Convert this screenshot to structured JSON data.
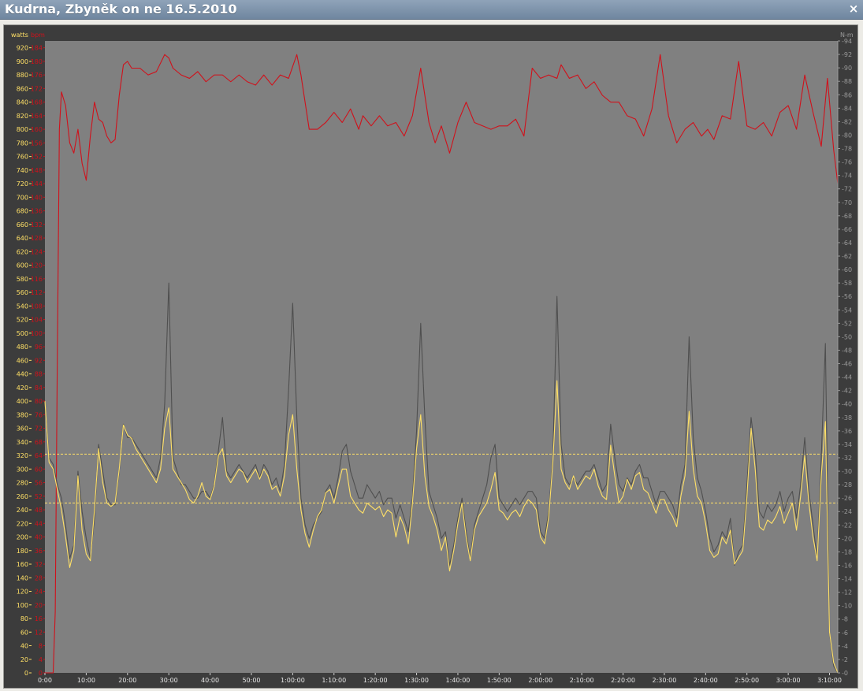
{
  "window": {
    "title": "Kudrna, Zbyněk on ne 16.5.2010",
    "close_glyph": "×"
  },
  "colors": {
    "plot_bg": "#808080",
    "outer_bg": "#3c3c3c",
    "watts": "#ffe066",
    "bpm": "#d0111b",
    "torque": "#4f4f4f",
    "threshold": "#ffe066",
    "right_axis": "#9a9a9a"
  },
  "chart_data": {
    "type": "line",
    "x_unit": "time (h:mm:ss)",
    "xlim": [
      0,
      192
    ],
    "x_ticks": [
      {
        "v": 0,
        "label": "0:00"
      },
      {
        "v": 10,
        "label": "10:00"
      },
      {
        "v": 20,
        "label": "20:00"
      },
      {
        "v": 30,
        "label": "30:00"
      },
      {
        "v": 40,
        "label": "40:00"
      },
      {
        "v": 50,
        "label": "50:00"
      },
      {
        "v": 60,
        "label": "1:00:00"
      },
      {
        "v": 70,
        "label": "1:10:00"
      },
      {
        "v": 80,
        "label": "1:20:00"
      },
      {
        "v": 90,
        "label": "1:30:00"
      },
      {
        "v": 100,
        "label": "1:40:00"
      },
      {
        "v": 110,
        "label": "1:50:00"
      },
      {
        "v": 120,
        "label": "2:00:00"
      },
      {
        "v": 130,
        "label": "2:10:00"
      },
      {
        "v": 140,
        "label": "2:20:00"
      },
      {
        "v": 150,
        "label": "2:30:00"
      },
      {
        "v": 160,
        "label": "2:40:00"
      },
      {
        "v": 170,
        "label": "2:50:00"
      },
      {
        "v": 180,
        "label": "3:00:00"
      },
      {
        "v": 190,
        "label": "3:10:00"
      }
    ],
    "axes": {
      "watts": {
        "label": "watts",
        "min": 0,
        "max": 930,
        "tick_step": 20,
        "tick_max": 920
      },
      "bpm": {
        "label": "bpm",
        "min": 0,
        "max": 186,
        "tick_step": 4,
        "tick_max": 184
      },
      "torque": {
        "label": "N-m",
        "min": 0,
        "max": 94,
        "tick_step": 2,
        "tick_max": 94
      }
    },
    "thresholds_watts": [
      322,
      250
    ],
    "series": [
      {
        "key": "bpm",
        "axis": "bpm",
        "x": [
          0,
          2,
          2.5,
          3,
          3.5,
          4,
          5,
          6,
          7,
          8,
          9,
          10,
          11,
          12,
          13,
          14,
          15,
          16,
          17,
          18,
          19,
          20,
          21,
          23,
          25,
          27,
          29,
          30,
          31,
          33,
          35,
          37,
          39,
          41,
          43,
          45,
          47,
          49,
          51,
          53,
          55,
          57,
          59,
          61,
          62,
          64,
          66,
          68,
          70,
          72,
          74,
          76,
          77,
          79,
          81,
          83,
          85,
          87,
          89,
          91,
          93,
          94.5,
          96,
          98,
          100,
          102,
          104,
          106,
          108,
          110,
          112,
          114,
          116,
          118,
          120,
          122,
          124,
          125,
          127,
          129,
          131,
          133,
          135,
          137,
          139,
          141,
          143,
          145,
          147,
          149,
          151,
          153,
          155,
          157,
          159,
          160.5,
          162,
          164,
          166,
          168,
          170,
          172,
          174,
          176,
          178,
          180,
          182,
          184,
          186,
          188,
          189.5,
          191,
          192
        ],
        "values": [
          0,
          0,
          18,
          92,
          160,
          171,
          167,
          156,
          153,
          160,
          150,
          145,
          158,
          168,
          163,
          162,
          158,
          156,
          157,
          170,
          179,
          180,
          178,
          178,
          176,
          177,
          182,
          181,
          178,
          176,
          175,
          177,
          174,
          176,
          176,
          174,
          176,
          174,
          173,
          176,
          173,
          176,
          175,
          182,
          176,
          160,
          160,
          162,
          165,
          162,
          166,
          160,
          164,
          161,
          164,
          161,
          162,
          158,
          164,
          178,
          162,
          156,
          161,
          153,
          162,
          168,
          162,
          161,
          160,
          161,
          161,
          163,
          158,
          178,
          175,
          176,
          175,
          179,
          175,
          176,
          172,
          174,
          170,
          168,
          168,
          164,
          163,
          158,
          166,
          182,
          164,
          156,
          160,
          162,
          158,
          160,
          157,
          164,
          163,
          180,
          161,
          160,
          162,
          158,
          165,
          167,
          160,
          176,
          165,
          155,
          175,
          154,
          144
        ]
      },
      {
        "key": "torque",
        "axis": "torque",
        "x": [
          0,
          1,
          2,
          3,
          4,
          5,
          6,
          7,
          8,
          9,
          10,
          11,
          12,
          13,
          14,
          15,
          16,
          17,
          18,
          19,
          20,
          21,
          22,
          23,
          24,
          25,
          26,
          27,
          28,
          29,
          30,
          31,
          32,
          33,
          34,
          35,
          36,
          37,
          38,
          39,
          40,
          41,
          42,
          43,
          44,
          45,
          46,
          47,
          48,
          49,
          50,
          51,
          52,
          53,
          54,
          55,
          56,
          57,
          58,
          59,
          60,
          61,
          62,
          63,
          64,
          65,
          66,
          67,
          68,
          69,
          70,
          71,
          72,
          73,
          74,
          75,
          76,
          77,
          78,
          79,
          80,
          81,
          82,
          83,
          84,
          85,
          86,
          87,
          88,
          89,
          90,
          91,
          92,
          93,
          94,
          95,
          96,
          97,
          98,
          99,
          100,
          101,
          102,
          103,
          104,
          105,
          106,
          107,
          108,
          109,
          110,
          111,
          112,
          113,
          114,
          115,
          116,
          117,
          118,
          119,
          120,
          121,
          122,
          123,
          124,
          125,
          126,
          127,
          128,
          129,
          130,
          131,
          132,
          133,
          134,
          135,
          136,
          137,
          138,
          139,
          140,
          141,
          142,
          143,
          144,
          145,
          146,
          147,
          148,
          149,
          150,
          151,
          152,
          153,
          154,
          155,
          156,
          157,
          158,
          159,
          160,
          161,
          162,
          163,
          164,
          165,
          166,
          167,
          168,
          169,
          170,
          171,
          172,
          173,
          174,
          175,
          176,
          177,
          178,
          179,
          180,
          181,
          182,
          183,
          184,
          185,
          186,
          187,
          188,
          189,
          190,
          191,
          192
        ],
        "values": [
          40,
          32,
          31,
          28,
          26,
          22,
          17,
          19,
          30,
          24,
          20,
          17,
          23,
          34,
          30,
          26,
          25,
          25,
          30,
          37,
          35,
          35,
          34,
          33,
          32,
          31,
          30,
          29,
          32,
          40,
          58,
          32,
          30,
          28,
          28,
          27,
          26,
          26,
          27,
          27,
          26,
          28,
          33,
          38,
          30,
          29,
          30,
          31,
          30,
          29,
          30,
          31,
          29,
          31,
          30,
          28,
          29,
          27,
          31,
          42,
          55,
          38,
          26,
          22,
          20,
          22,
          23,
          24,
          27,
          28,
          26,
          29,
          33,
          34,
          30,
          28,
          26,
          26,
          28,
          27,
          26,
          27,
          25,
          26,
          26,
          23,
          25,
          23,
          21,
          26,
          36,
          52,
          38,
          27,
          25,
          23,
          20,
          21,
          16,
          19,
          23,
          26,
          21,
          17,
          22,
          24,
          26,
          28,
          32,
          34,
          26,
          25,
          24,
          25,
          26,
          25,
          26,
          27,
          27,
          26,
          21,
          20,
          24,
          32,
          56,
          34,
          29,
          28,
          29,
          28,
          29,
          30,
          30,
          31,
          29,
          27,
          28,
          37,
          32,
          28,
          27,
          29,
          28,
          30,
          31,
          29,
          29,
          27,
          25,
          27,
          27,
          26,
          25,
          23,
          28,
          31,
          50,
          35,
          29,
          27,
          24,
          20,
          18,
          19,
          21,
          20,
          23,
          16,
          18,
          19,
          28,
          38,
          33,
          24,
          23,
          25,
          24,
          25,
          27,
          24,
          26,
          27,
          23,
          28,
          35,
          27,
          22,
          17,
          32,
          49,
          6,
          1,
          0
        ]
      },
      {
        "key": "watts",
        "axis": "watts",
        "x": [
          0,
          1,
          2,
          3,
          4,
          5,
          6,
          7,
          8,
          9,
          10,
          11,
          12,
          13,
          14,
          15,
          16,
          17,
          18,
          19,
          20,
          21,
          22,
          23,
          24,
          25,
          26,
          27,
          28,
          29,
          30,
          31,
          32,
          33,
          34,
          35,
          36,
          37,
          38,
          39,
          40,
          41,
          42,
          43,
          44,
          45,
          46,
          47,
          48,
          49,
          50,
          51,
          52,
          53,
          54,
          55,
          56,
          57,
          58,
          59,
          60,
          61,
          62,
          63,
          64,
          65,
          66,
          67,
          68,
          69,
          70,
          71,
          72,
          73,
          74,
          75,
          76,
          77,
          78,
          79,
          80,
          81,
          82,
          83,
          84,
          85,
          86,
          87,
          88,
          89,
          90,
          91,
          92,
          93,
          94,
          95,
          96,
          97,
          98,
          99,
          100,
          101,
          102,
          103,
          104,
          105,
          106,
          107,
          108,
          109,
          110,
          111,
          112,
          113,
          114,
          115,
          116,
          117,
          118,
          119,
          120,
          121,
          122,
          123,
          124,
          125,
          126,
          127,
          128,
          129,
          130,
          131,
          132,
          133,
          134,
          135,
          136,
          137,
          138,
          139,
          140,
          141,
          142,
          143,
          144,
          145,
          146,
          147,
          148,
          149,
          150,
          151,
          152,
          153,
          154,
          155,
          156,
          157,
          158,
          159,
          160,
          161,
          162,
          163,
          164,
          165,
          166,
          167,
          168,
          169,
          170,
          171,
          172,
          173,
          174,
          175,
          176,
          177,
          178,
          179,
          180,
          181,
          182,
          183,
          184,
          185,
          186,
          187,
          188,
          189,
          190,
          191,
          192
        ],
        "values": [
          400,
          310,
          300,
          270,
          240,
          200,
          155,
          180,
          290,
          210,
          175,
          165,
          240,
          330,
          280,
          250,
          245,
          250,
          300,
          365,
          350,
          345,
          330,
          320,
          310,
          300,
          290,
          280,
          300,
          360,
          390,
          300,
          290,
          280,
          270,
          255,
          250,
          260,
          280,
          260,
          255,
          275,
          320,
          330,
          290,
          280,
          290,
          300,
          295,
          280,
          290,
          300,
          285,
          300,
          290,
          270,
          275,
          260,
          290,
          350,
          380,
          300,
          240,
          205,
          185,
          210,
          230,
          240,
          265,
          270,
          250,
          275,
          300,
          300,
          260,
          250,
          240,
          235,
          250,
          245,
          240,
          245,
          230,
          240,
          235,
          200,
          230,
          215,
          190,
          250,
          330,
          380,
          290,
          245,
          230,
          210,
          180,
          200,
          150,
          180,
          220,
          250,
          200,
          165,
          210,
          230,
          240,
          250,
          270,
          295,
          240,
          235,
          225,
          235,
          240,
          230,
          245,
          255,
          250,
          240,
          200,
          190,
          230,
          310,
          430,
          300,
          280,
          270,
          290,
          270,
          280,
          290,
          285,
          300,
          275,
          260,
          255,
          335,
          290,
          250,
          260,
          285,
          270,
          290,
          295,
          270,
          265,
          250,
          235,
          255,
          255,
          240,
          230,
          215,
          260,
          290,
          385,
          300,
          260,
          250,
          220,
          180,
          170,
          175,
          200,
          190,
          210,
          160,
          170,
          180,
          260,
          360,
          300,
          215,
          210,
          225,
          220,
          230,
          245,
          220,
          235,
          250,
          210,
          260,
          320,
          250,
          200,
          165,
          290,
          370,
          60,
          15,
          0
        ]
      }
    ]
  }
}
